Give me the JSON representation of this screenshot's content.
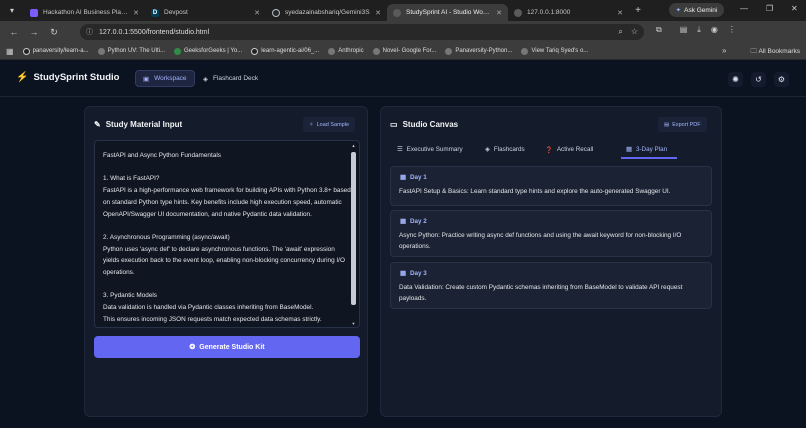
{
  "browser": {
    "tabs": [
      {
        "title": "Hackathon AI Business Plan -",
        "favicon_color": "#7c5cff"
      },
      {
        "title": "Devpost",
        "favicon_color": "#003e54"
      },
      {
        "title": "syedazainabshariq/Gemini3S",
        "favicon_color": "#24292f"
      },
      {
        "title": "StudySprint AI - Studio Works",
        "favicon_color": "#5a5a5a"
      },
      {
        "title": "127.0.0.1:8000",
        "favicon_color": "#5a5a5a"
      }
    ],
    "ask_gemini": "Ask Gemini",
    "url": "127.0.0.1:5500/frontend/studio.html",
    "bookmarks": [
      "panaversity/learn-a...",
      "Python UV: The Ulti...",
      "GeeksforGeeks | Yo...",
      "learn-agentic-ai/06_...",
      "Anthropic",
      "Novel- Google For...",
      "Panaversity-Python...",
      "View Tariq Syed's o..."
    ],
    "all_bookmarks": "All Bookmarks"
  },
  "app": {
    "brand": "StudySprint Studio",
    "nav": [
      {
        "label": "Workspace"
      },
      {
        "label": "Flashcard Deck"
      }
    ]
  },
  "input_panel": {
    "title": "Study Material Input",
    "load_sample": "Load Sample",
    "text": "FastAPI and Async Python Fundamentals\n\n1. What is FastAPI?\nFastAPI is a high-performance web framework for building APIs with Python 3.8+ based on standard Python type hints. Key benefits include high execution speed, automatic OpenAPI/Swagger UI documentation, and native Pydantic data validation.\n\n2. Asynchronous Programming (async/await)\nPython uses 'async def' to declare asynchronous functions. The 'await' expression yields execution back to the event loop, enabling non-blocking concurrency during I/O operations.\n\n3. Pydantic Models\nData validation is handled via Pydantic classes inheriting from BaseModel.\nThis ensures incoming JSON requests match expected data schemas strictly.",
    "generate_button": "Generate Studio Kit"
  },
  "canvas": {
    "title": "Studio Canvas",
    "export_pdf": "Export PDF",
    "tabs": [
      {
        "label": "Executive Summary"
      },
      {
        "label": "Flashcards"
      },
      {
        "label": "Active Recall"
      },
      {
        "label": "3-Day Plan"
      }
    ],
    "active_tab": "3-Day Plan",
    "days": [
      {
        "label": "Day 1",
        "text": "FastAPI Setup & Basics: Learn standard type hints and explore the auto-generated Swagger UI."
      },
      {
        "label": "Day 2",
        "text": "Async Python: Practice writing async def functions and using the await keyword for non-blocking I/O operations."
      },
      {
        "label": "Day 3",
        "text": "Data Validation: Create custom Pydantic schemas inheriting from BaseModel to validate API request payloads."
      }
    ]
  },
  "colors": {
    "accent": "#6366f1",
    "accent_text": "#a5b4fc",
    "background": "#0b1220",
    "panel": "#141c2b"
  }
}
